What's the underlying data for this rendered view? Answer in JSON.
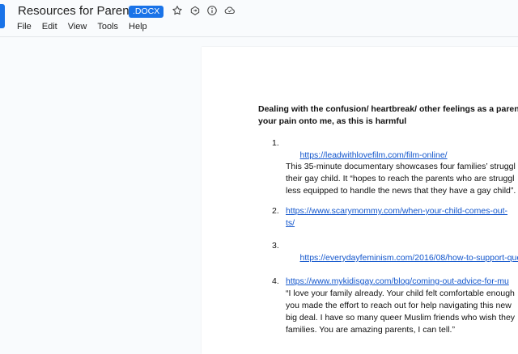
{
  "header": {
    "title": "Resources for Parents",
    "badge": ".DOCX",
    "icons": [
      "star-icon",
      "move-to-folder-icon",
      "info-icon",
      "cloud-status-icon"
    ]
  },
  "menu": {
    "file": "File",
    "edit": "Edit",
    "view": "View",
    "tools": "Tools",
    "help": "Help"
  },
  "document": {
    "heading_line1": "Dealing with the confusion/ heartbreak/ other feelings as a parent,",
    "heading_line2": "your pain onto me, as this is harmful",
    "items": [
      {
        "number": "1.",
        "link": "https://leadwithlovefilm.com/film-online/",
        "text_lines": [
          "This 35-minute documentary showcases four families’ struggl",
          "their gay child. It “hopes to reach the parents who are struggl",
          "less equipped to handle the news that they have a gay child”."
        ]
      },
      {
        "number": "2.",
        "link_line1": "https://www.scarymommy.com/when-your-child-comes-out-",
        "link_line2": "ts/"
      },
      {
        "number": "3.",
        "link": "https://everydayfeminism.com/2016/08/how-to-support-que"
      },
      {
        "number": "4.",
        "link": "https://www.mykidisgay.com/blog/coming-out-advice-for-mu",
        "text_lines": [
          "“I love your family already. Your child felt comfortable enough",
          "you made the effort to reach out for help navigating this new",
          "big deal. I have so many queer Muslim friends who wish they",
          "families. You are amazing parents, I can tell.”"
        ]
      }
    ]
  },
  "colors": {
    "accent": "#1a73e8",
    "link": "#1155cc",
    "background": "#f9fbfd"
  }
}
